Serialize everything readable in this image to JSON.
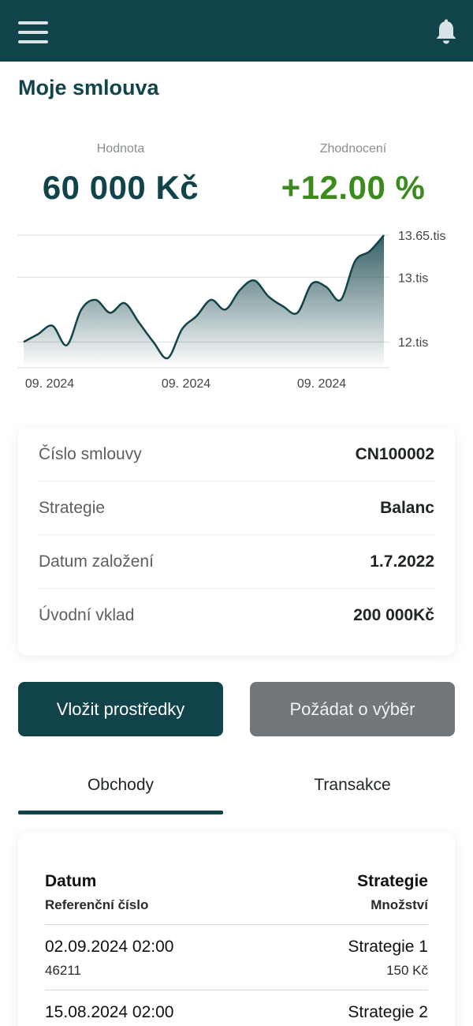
{
  "header": {
    "menu_icon": "hamburger-menu-icon",
    "bell_icon": "bell-icon"
  },
  "page": {
    "title": "Moje smlouva"
  },
  "kpis": {
    "value_label": "Hodnota",
    "value": "60 000 Kč",
    "gain_label": "Zhodnocení",
    "gain": "+12.00 %",
    "gain_color": "#3a8b1c"
  },
  "chart_data": {
    "type": "area",
    "y_tick_labels": [
      "13.65.tis",
      "13.tis",
      "12.tis"
    ],
    "y_ticks": [
      13.65,
      13.0,
      12.0
    ],
    "x_tick_labels": [
      "09. 2024",
      "09. 2024",
      "09. 2024"
    ],
    "ylim": [
      11.6,
      13.65
    ],
    "grid": true,
    "line_color": "#11434a",
    "series": [
      {
        "values": [
          12.0,
          12.12,
          12.25,
          11.95,
          12.5,
          12.65,
          12.45,
          12.6,
          12.3,
          12.0,
          11.75,
          12.2,
          12.4,
          12.65,
          12.5,
          12.8,
          12.95,
          12.7,
          12.55,
          12.45,
          12.9,
          12.85,
          12.65,
          13.25,
          13.4,
          13.65
        ]
      }
    ]
  },
  "contract": {
    "rows": [
      {
        "label": "Číslo smlouvy",
        "value": "CN100002"
      },
      {
        "label": "Strategie",
        "value": "Balanc"
      },
      {
        "label": "Datum založení",
        "value": "1.7.2022"
      },
      {
        "label": "Úvodní vklad",
        "value": "200 000Kč"
      }
    ]
  },
  "actions": {
    "deposit": "Vložit prostředky",
    "withdraw": "Požádat o výběr"
  },
  "tabs": [
    {
      "label": "Obchody",
      "active": true
    },
    {
      "label": "Transakce",
      "active": false
    }
  ],
  "trades": {
    "header": {
      "date": "Datum",
      "ref": "Referenční číslo",
      "strategy": "Strategie",
      "amount": "Množství"
    },
    "rows": [
      {
        "date": "02.09.2024 02:00",
        "ref": "46211",
        "strategy": "Strategie 1",
        "amount": "150 Kč"
      },
      {
        "date": "15.08.2024 02:00",
        "ref": "",
        "strategy": "Strategie 2",
        "amount": ""
      }
    ]
  }
}
